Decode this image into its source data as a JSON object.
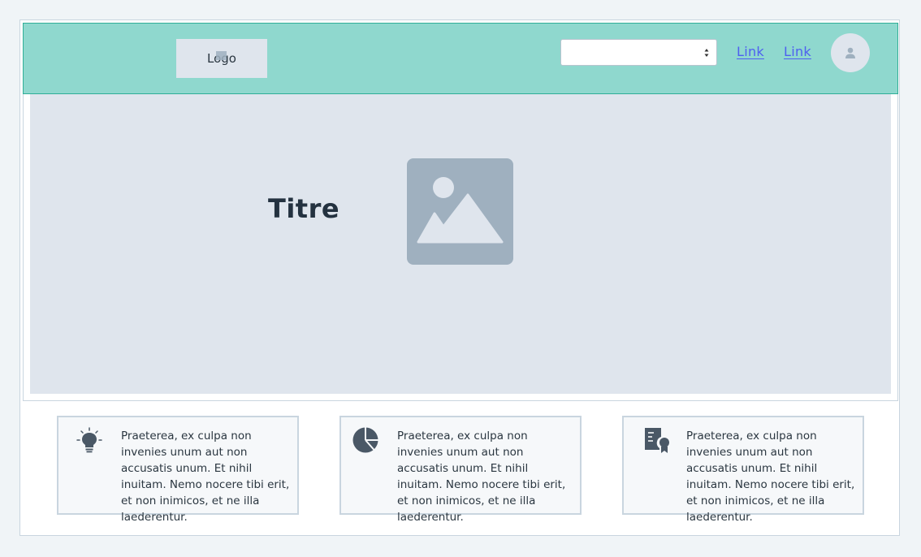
{
  "header": {
    "logo_label": "Logo",
    "select_value": "",
    "links": [
      "Link",
      "Link"
    ],
    "avatar_icon": "user-icon"
  },
  "hero": {
    "title": "Titre",
    "image_icon": "image-placeholder-icon"
  },
  "features": [
    {
      "icon": "lightbulb-icon",
      "text": "Praeterea, ex culpa non invenies unum aut non accusatis unum. Et nihil inuitam. Nemo nocere tibi erit, et non inimicos, et ne illa laederentur."
    },
    {
      "icon": "pie-chart-icon",
      "text": "Praeterea, ex culpa non invenies unum aut non accusatis unum. Et nihil inuitam. Nemo nocere tibi erit, et non inimicos, et ne illa laederentur."
    },
    {
      "icon": "certificate-icon",
      "text": "Praeterea, ex culpa non invenies unum aut non accusatis unum. Et nihil inuitam. Nemo nocere tibi erit, et non inimicos, et ne illa laederentur."
    }
  ],
  "colors": {
    "header_bg": "#8fd8ce",
    "header_border": "#2fae97",
    "link": "#4e5ff0",
    "placeholder_bg": "#dfe5ed",
    "image_fill": "#9fb0bf",
    "icon_dark": "#4a5866"
  }
}
